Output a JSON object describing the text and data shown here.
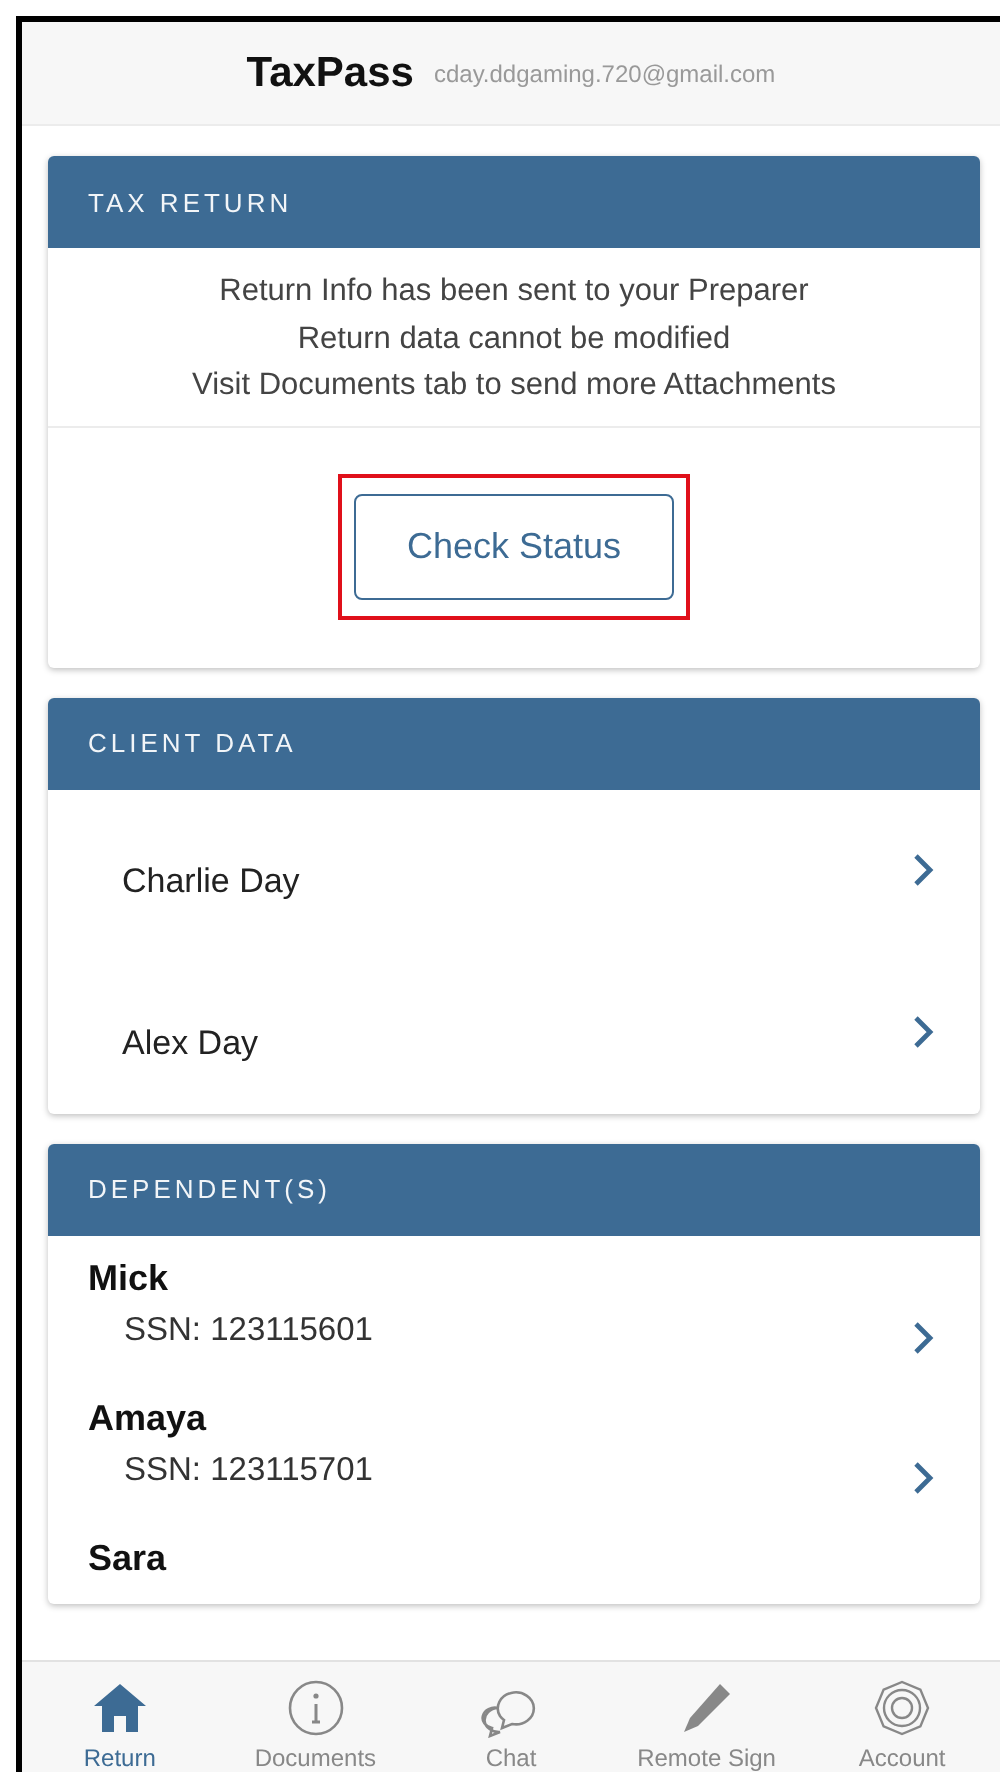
{
  "header": {
    "title": "TaxPass",
    "email": "cday.ddgaming.720@gmail.com"
  },
  "tax_return": {
    "title": "TAX RETURN",
    "messages": [
      "Return Info has been sent to your Preparer",
      "Return data cannot be modified",
      "Visit Documents tab to send more Attachments"
    ],
    "button": "Check Status",
    "highlighted": true
  },
  "client_data": {
    "title": "CLIENT DATA",
    "rows": [
      {
        "name": "Charlie Day"
      },
      {
        "name": "Alex Day"
      }
    ]
  },
  "dependents": {
    "title": "DEPENDENT(S)",
    "rows": [
      {
        "name": "Mick",
        "ssn": "SSN: 123115601"
      },
      {
        "name": "Amaya",
        "ssn": "SSN: 123115701"
      },
      {
        "name": "Sara"
      }
    ]
  },
  "tabs": [
    {
      "label": "Return",
      "kind": "home",
      "selected": true
    },
    {
      "label": "Documents",
      "kind": "info",
      "selected": false
    },
    {
      "label": "Chat",
      "kind": "chat",
      "selected": false
    },
    {
      "label": "Remote Sign",
      "kind": "pencil",
      "selected": false
    },
    {
      "label": "Account",
      "kind": "gear",
      "selected": false
    }
  ]
}
